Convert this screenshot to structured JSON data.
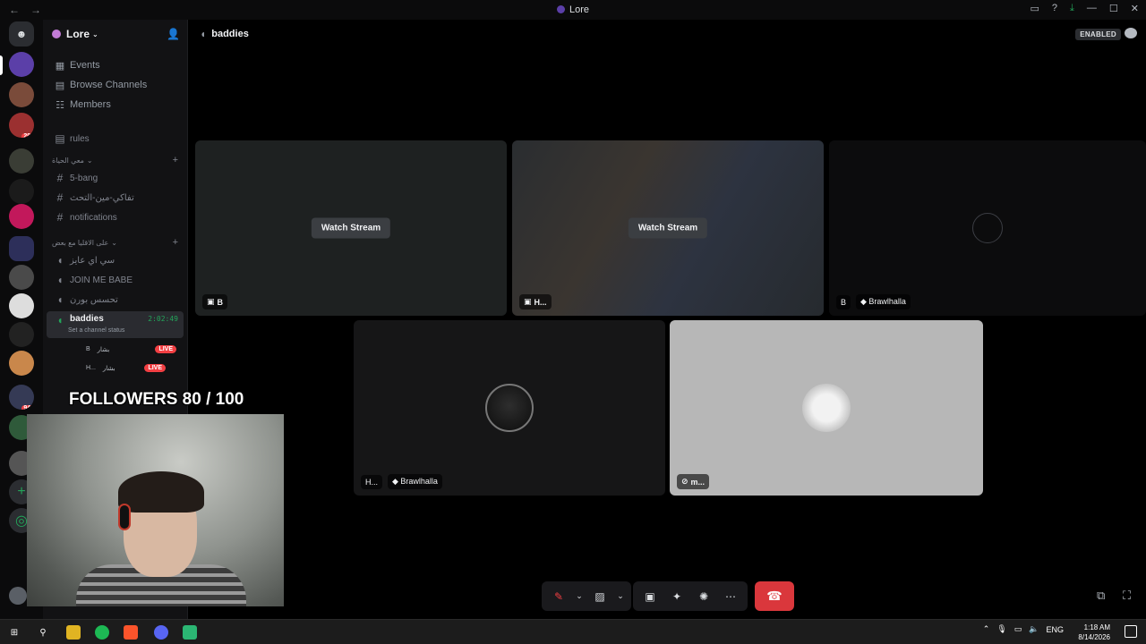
{
  "window": {
    "title": "Lore"
  },
  "rail": {
    "badges": [
      "206",
      "940"
    ]
  },
  "guild": {
    "name": "Lore"
  },
  "nav": {
    "events": "Events",
    "browse": "Browse Channels",
    "members": "Members"
  },
  "channels": {
    "rules": "rules",
    "cat1": "معي الحياة",
    "text": [
      "5-bang",
      "تفاكي-مين-التحث",
      "notifications"
    ],
    "cat2": "على الاقليا مع بعض",
    "voice": [
      "سي اي عايز",
      "JOIN ME BABE",
      "تحسس بورن"
    ],
    "active": {
      "name": "baddies",
      "timer": "2:02:49",
      "status": "Set a channel status"
    },
    "users": [
      {
        "name": "بشار",
        "initial": "B",
        "live": "LIVE"
      },
      {
        "name": "بشار",
        "initial": "H...",
        "live": "LIVE"
      }
    ]
  },
  "header": {
    "channel": "baddies",
    "enabled": "ENABLED"
  },
  "tiles": {
    "t1": {
      "watch": "Watch Stream",
      "tag": "B"
    },
    "t2": {
      "watch": "Watch Stream",
      "tag": "H..."
    },
    "t3": {
      "tag": "B",
      "game": "Brawlhalla"
    },
    "t4": {
      "tag": "H...",
      "game": "Brawlhalla"
    },
    "t5": {
      "tag": "m..."
    }
  },
  "overlay": {
    "followers": "FOLLOWERS 80 / 100"
  },
  "taskbar": {
    "lang": "ENG",
    "time": "1:18 AM",
    "date": "8/14/2026"
  },
  "colors": {
    "accent": "#23a55a",
    "danger": "#da373c",
    "live": "#f23f43"
  }
}
